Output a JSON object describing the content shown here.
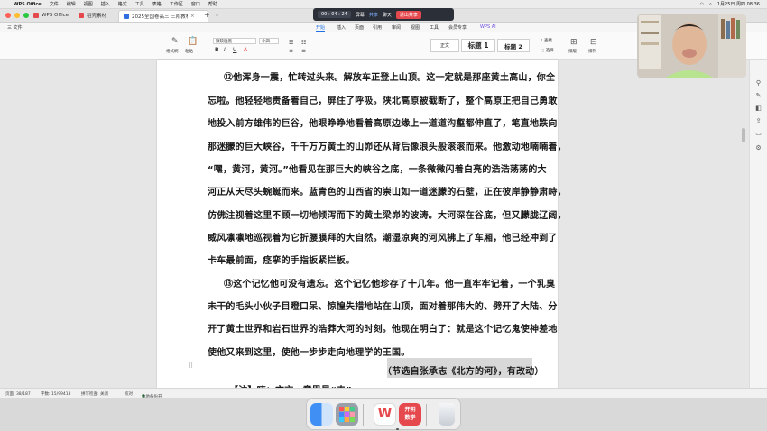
{
  "menubar": {
    "app": "WPS Office",
    "items": [
      "文件",
      "编辑",
      "视图",
      "插入",
      "格式",
      "工具",
      "表格",
      "工作区",
      "窗口",
      "帮助"
    ],
    "datetime": "1月25日 周四 08:36"
  },
  "tabs": [
    {
      "label": "WPS Office",
      "color": "#e5484d"
    },
    {
      "label": "稻壳素材",
      "color": "#e5484d"
    },
    {
      "label": "2025全国卷高三 三阶教材…",
      "color": "#2f6fe0"
    }
  ],
  "meeting": {
    "timer": "00 : 04 : 24",
    "items": [
      "屏幕",
      "共享",
      "聊天"
    ],
    "leave": "退出共享"
  },
  "ribbon_tabs": {
    "file": "三 文件",
    "items": [
      "开始",
      "插入",
      "页面",
      "引用",
      "审阅",
      "视图",
      "工具",
      "会员专享"
    ],
    "ai": "WPS AI",
    "selected": "开始"
  },
  "ribbon": {
    "format_painter": "格式刷",
    "paste": "粘贴",
    "font_name": "微软雅黑",
    "font_size": "小四",
    "style_normal": "正文",
    "style_h1": "标题 1",
    "style_h2": "标题 2",
    "find": "查找",
    "select": "选择",
    "format": "排版",
    "sort": "排列"
  },
  "document": {
    "lines": [
      "⑫他浑身一震，忙转过头来。解放车正登上山顶。这一定就是那座黄土高山，你全",
      "忘啦。他轻轻地责备着自己，屏住了呼吸。陕北高原被截断了，整个高原正把自己勇敢",
      "地投入前方雄伟的巨谷，他眼睁睁地看着高原边缘上一道道沟壑都伸直了，笔直地跌向",
      "那迷朦的巨大峡谷，千千万万黄土的山峁还从背后像浪头般滚滚而来。他激动地喃喃着，",
      "“嘿，黄河，黄河。”他看见在那巨大的峡谷之底，一条微微闪着白亮的浩浩荡荡的大",
      "河正从天尽头蜿蜒而来。蓝青色的山西省的崇山如一道迷朦的石壁，正在彼岸静静肃峙，",
      "仿佛注视着这里不顾一切地倾泻而下的黄土梁峁的波涛。大河深在谷底，但又朦胧辽阔，",
      "威风凛凛地巡视着为它折腰膜拜的大自然。潮湿凉爽的河风拂上了车厢，他已经冲到了",
      "卡车最前面，痉挛的手指扳紧拦板。",
      "⑬这个记忆他可没有遗忘。这个记忆他珍存了十几年。他一直牢牢记着，一个乳臭",
      "未干的毛头小伙子目瞪口呆、惊惶失措地站在山顶，面对着那伟大的、劈开了大陆、分",
      "开了黄土世界和岩石世界的浩莽大河的时刻。他现在明白了：就是这个记忆鬼使神差地",
      "使他又来到这里，使他一步步走向地理学的王国。"
    ],
    "source": "（节选自张承志《北方的河》，有改动）",
    "note_partial": "【注】喃：方言，意思是“去”"
  },
  "statusbar": {
    "page": "页面: 38/187",
    "words": "字数: 15/99413",
    "spell": "拼写检查: 关闭",
    "proof": "校对",
    "doc": "本地备份开"
  },
  "dock": [
    "访达",
    "启动台",
    "WPS",
    "开明数学",
    "废纸篓"
  ],
  "colors": {
    "accent": "#1f6fe5",
    "leave": "#e5484d",
    "page": "#ffffff"
  }
}
